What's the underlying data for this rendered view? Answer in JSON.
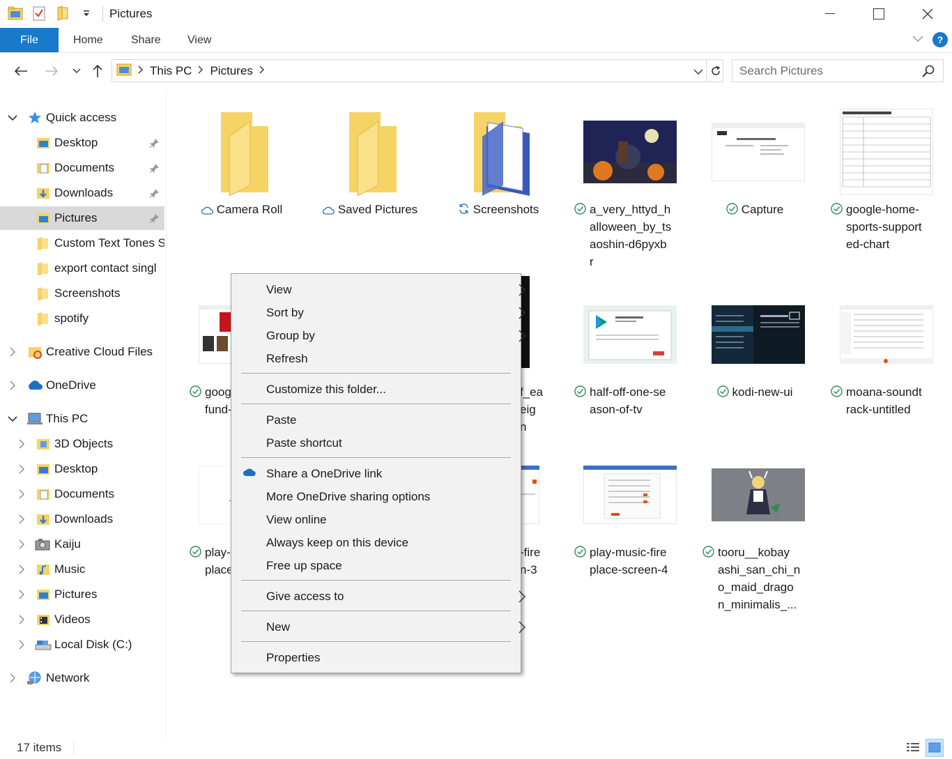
{
  "window": {
    "title": "Pictures"
  },
  "ribbon": {
    "tabs": [
      "File",
      "Home",
      "Share",
      "View"
    ]
  },
  "address": {
    "crumbs": [
      "This PC",
      "Pictures"
    ]
  },
  "search": {
    "placeholder": "Search Pictures"
  },
  "sidebar": {
    "quick_access": {
      "label": "Quick access"
    },
    "quick_items": [
      "Desktop",
      "Documents",
      "Downloads",
      "Pictures",
      "Custom Text Tones S",
      "export contact singl",
      "Screenshots",
      "spotify"
    ],
    "creative_cloud": "Creative Cloud Files",
    "onedrive": "OneDrive",
    "this_pc": "This PC",
    "pc_items": [
      "3D Objects",
      "Desktop",
      "Documents",
      "Downloads",
      "Kaiju",
      "Music",
      "Pictures",
      "Videos",
      "Local Disk (C:)"
    ],
    "network": "Network"
  },
  "items": [
    {
      "lines": [
        "Camera Roll"
      ]
    },
    {
      "lines": [
        "Saved Pictures"
      ]
    },
    {
      "lines": [
        "Screenshots"
      ]
    },
    {
      "lines": [
        "a_very_httyd_h",
        "alloween_by_ts",
        "aoshin-d6pyxb",
        "r"
      ]
    },
    {
      "lines": [
        "Capture"
      ]
    },
    {
      "lines": [
        "google-home-",
        "sports-support",
        "ed-chart"
      ]
    },
    {
      "lines": [
        "goog",
        "fund-"
      ]
    },
    {
      "lines": [
        "f_ea",
        "eig",
        "n"
      ]
    },
    {
      "lines": [
        "half-off-one-se",
        "ason-of-tv"
      ]
    },
    {
      "lines": [
        "kodi-new-ui"
      ]
    },
    {
      "lines": [
        "moana-soundt",
        "rack-untitled"
      ]
    },
    {
      "lines": [
        "play-",
        "place"
      ]
    },
    {
      "lines": [
        "-fire",
        "n-3"
      ]
    },
    {
      "lines": [
        "play-music-fire",
        "place-screen-4"
      ]
    },
    {
      "lines": [
        "tooru__kobay",
        "ashi_san_chi_n",
        "o_maid_drago",
        "n_minimalis_..."
      ]
    }
  ],
  "context_menu": {
    "view": "View",
    "sort_by": "Sort by",
    "group_by": "Group by",
    "refresh": "Refresh",
    "customize": "Customize this folder...",
    "paste": "Paste",
    "paste_shortcut": "Paste shortcut",
    "share_onedrive": "Share a OneDrive link",
    "more_onedrive": "More OneDrive sharing options",
    "view_online": "View online",
    "always_keep": "Always keep on this device",
    "free_up": "Free up space",
    "give_access": "Give access to",
    "new": "New",
    "properties": "Properties"
  },
  "statusbar": {
    "count": "17 items"
  },
  "colors": {
    "accent": "#1979ca",
    "folder": "#f6d365",
    "sync_green": "#2e8b57",
    "onedrive_blue": "#1e6fc4"
  }
}
